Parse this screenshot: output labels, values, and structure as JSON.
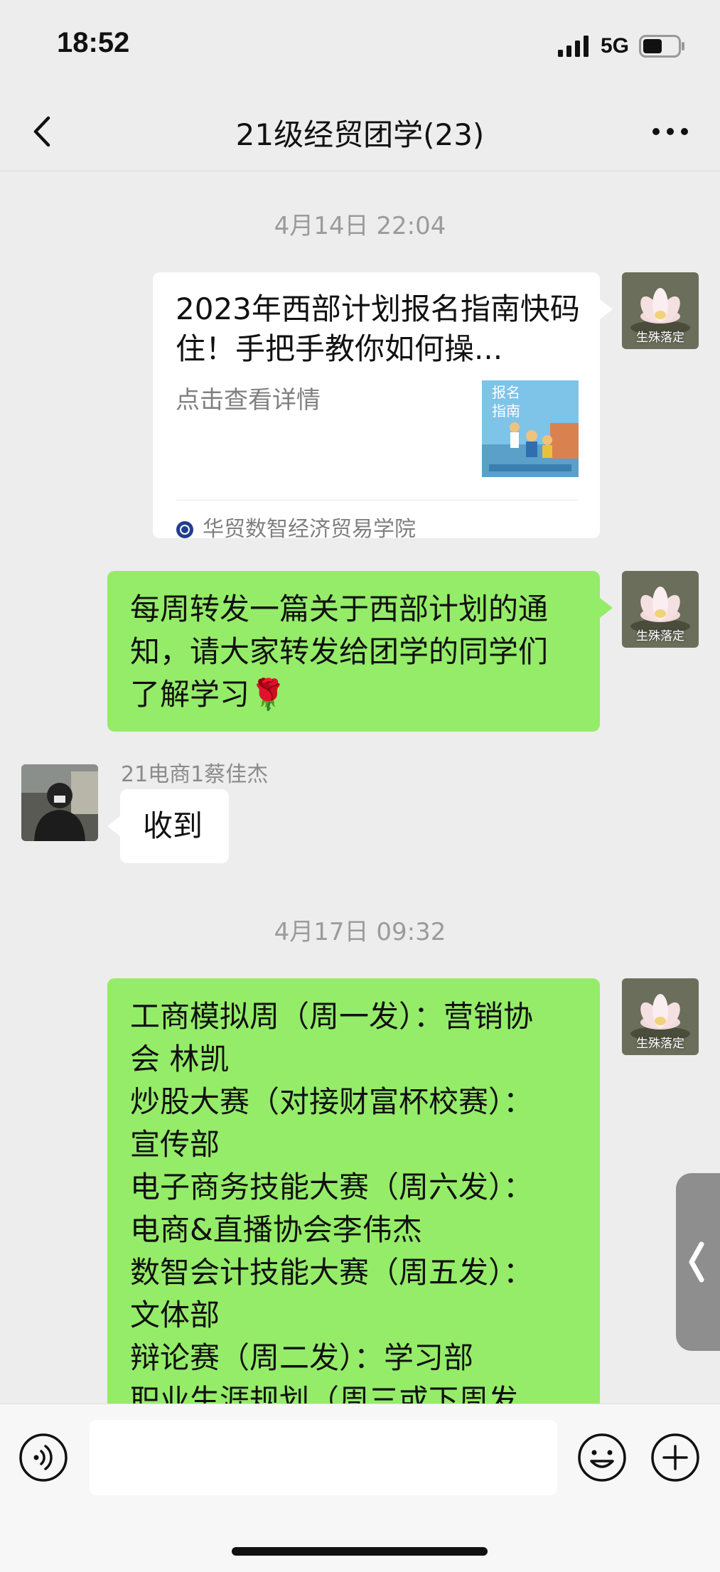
{
  "status_bar": {
    "time": "18:52",
    "network": "5G",
    "signal_icon": "signal-bars-icon",
    "battery_icon": "battery-icon"
  },
  "header": {
    "title": "21级经贸团学(23)",
    "back_icon": "chevron-left-icon",
    "more_icon": "more-dots-icon"
  },
  "messages": {
    "ts1": "4月14日 22:04",
    "card": {
      "title": "2023年西部计划报名指南快码住！手把手教你如何操...",
      "desc": "点击查看详情",
      "thumb_text_1": "报名",
      "thumb_text_2": "指南",
      "source": "华贸数智经济贸易学院"
    },
    "msg1": {
      "lines": [
        "每周转发一篇关于西部计划的通",
        "知，请大家转发给团学的同学们",
        "了解学习"
      ],
      "emoji": "🌹"
    },
    "sender2": "21电商1蔡佳杰",
    "msg2": "收到",
    "ts2": "4月17日 09:32",
    "msg3": {
      "lines": [
        "工商模拟周（周一发）：营销协",
        "会 林凯",
        "炒股大赛（对接财富杯校赛）：",
        "宣传部",
        "电子商务技能大赛（周六发）：",
        "电商&直播协会李伟杰",
        "数智会计技能大赛（周五发）：",
        "文体部",
        "辩论赛（周二发）：学习部",
        "职业生涯规划（周三或下周发"
      ]
    },
    "self_avatar_caption": "生殊落定"
  },
  "input_bar": {
    "placeholder": "",
    "voice_icon": "voice-icon",
    "emoji_icon": "emoji-smile-icon",
    "plus_icon": "plus-circle-icon"
  },
  "colors": {
    "background": "#ededed",
    "bubble_green": "#95ec69",
    "bubble_white": "#ffffff"
  }
}
